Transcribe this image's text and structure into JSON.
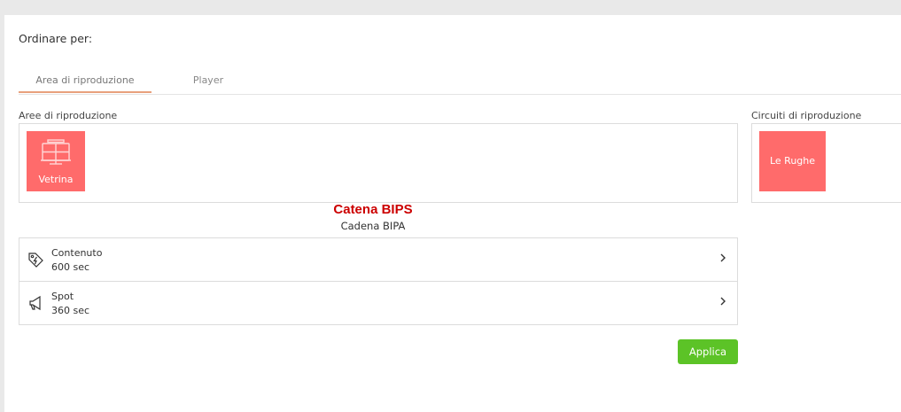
{
  "page": {
    "sort_label": "Ordinare per:",
    "tabs": [
      {
        "label": "Area di riproduzione",
        "active": true
      },
      {
        "label": "Player",
        "active": false
      }
    ]
  },
  "areas": {
    "label": "Aree di riproduzione",
    "tiles": [
      {
        "label": "Vetrina",
        "icon": "storefront-icon"
      }
    ]
  },
  "circuits": {
    "label": "Circuiti di riproduzione",
    "tiles": [
      {
        "label": "Le Rughe"
      }
    ]
  },
  "chain": {
    "title": "Catena BIPS",
    "subtitle": "Cadena BIPA"
  },
  "items": [
    {
      "name": "Contenuto",
      "value": "600 sec",
      "icon": "tag-lightning-icon"
    },
    {
      "name": "Spot",
      "value": "360 sec",
      "icon": "megaphone-icon"
    }
  ],
  "actions": {
    "apply_label": "Applica"
  },
  "colors": {
    "tile": "#ff6b6b",
    "apply": "#5cc327",
    "catena": "#cc0000",
    "tab_underline": "#e8a07c"
  }
}
